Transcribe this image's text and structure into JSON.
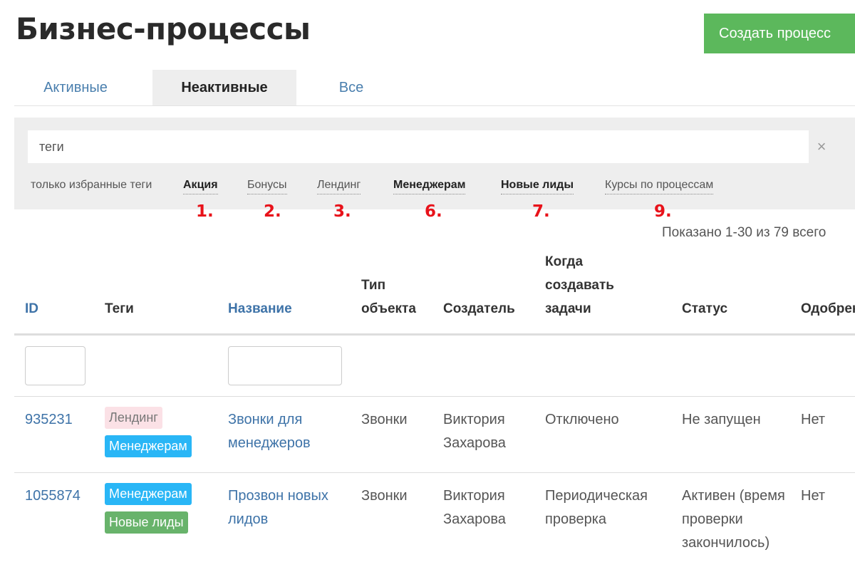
{
  "header": {
    "title": "Бизнес-процессы",
    "create_button": "Создать процесс"
  },
  "tabs": [
    {
      "label": "Активные",
      "active": false
    },
    {
      "label": "Неактивные",
      "active": true
    },
    {
      "label": "Все",
      "active": false
    }
  ],
  "filter": {
    "tags_input_value": "теги",
    "clear_symbol": "×",
    "favorites_label": "только избранные теги",
    "tags": [
      {
        "label": "Акция",
        "bold": true
      },
      {
        "label": "Бонусы",
        "bold": false
      },
      {
        "label": "Лендинг",
        "bold": false
      },
      {
        "label": "Менеджерам",
        "bold": true
      },
      {
        "label": "Новые лиды",
        "bold": true
      },
      {
        "label": "Курсы по процессам",
        "bold": false
      }
    ]
  },
  "annotations": [
    "1.",
    "2.",
    "3.",
    "6.",
    "7.",
    "9."
  ],
  "annotation_color": "#e8121a",
  "summary": "Показано 1-30 из 79 всего",
  "table": {
    "headers": {
      "id": "ID",
      "tags": "Теги",
      "name": "Название",
      "type": "Тип объекта",
      "creator": "Создатель",
      "when": "Когда создавать задачи",
      "status": "Статус",
      "approved": "Одобрен"
    },
    "rows": [
      {
        "id": "935231",
        "tags": [
          {
            "label": "Лендинг",
            "color": "pink"
          },
          {
            "label": "Менеджерам",
            "color": "blue"
          }
        ],
        "name": "Звонки для менеджеров",
        "type": "Звонки",
        "creator": "Виктория Захарова",
        "when": "Отключено",
        "status": "Не запущен",
        "approved": "Нет"
      },
      {
        "id": "1055874",
        "tags": [
          {
            "label": "Менеджерам",
            "color": "blue"
          },
          {
            "label": "Новые лиды",
            "color": "green"
          }
        ],
        "name": "Прозвон новых лидов",
        "type": "Звонки",
        "creator": "Виктория Захарова",
        "when": "Периодическая проверка",
        "status": "Активен (время проверки закончилось)",
        "approved": "Нет"
      }
    ]
  },
  "colors": {
    "accent_green": "#5cb85c",
    "link_blue": "#3e73a8",
    "badge_blue": "#29b6f6",
    "badge_green": "#68b36b",
    "badge_pink": "#fbe1e6"
  }
}
